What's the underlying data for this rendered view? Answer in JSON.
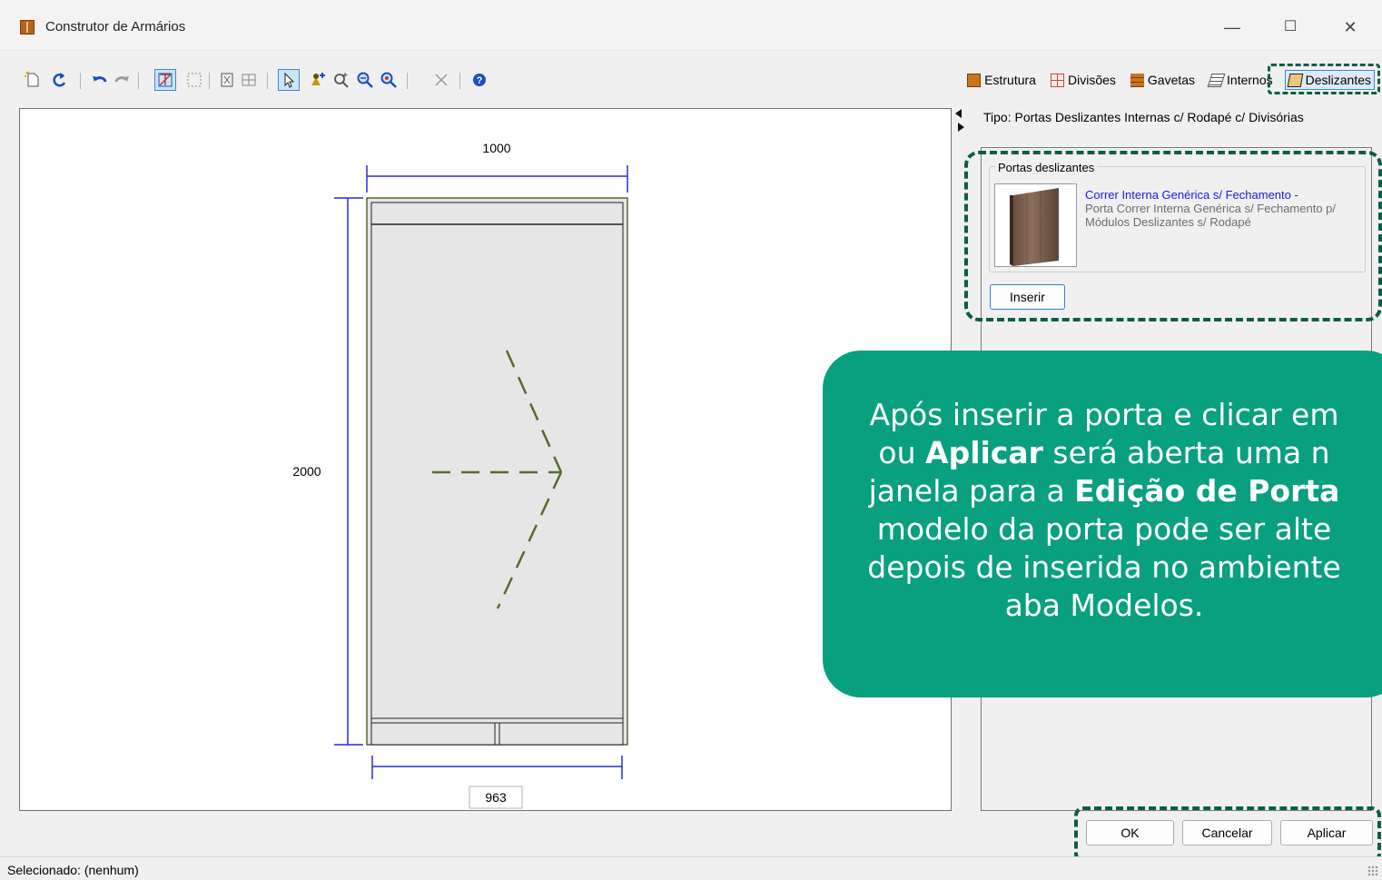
{
  "window": {
    "title": "Construtor de Armários",
    "minimize_glyph": "—",
    "maximize_glyph": "☐",
    "close_glyph": "✕"
  },
  "toolbar": {
    "icons": [
      "new-icon",
      "redo-icon",
      "undo-icon",
      "redo-disabled-icon",
      "dimension-icon",
      "select-area-icon",
      "frame-icon",
      "grid-icon",
      "pointer-icon",
      "add-item-icon",
      "zoom-in-icon",
      "zoom-out-icon",
      "zoom-fit-icon",
      "delete-icon",
      "help-icon"
    ]
  },
  "tabs": [
    {
      "label": "Estrutura",
      "icon": "cabinet-icon"
    },
    {
      "label": "Divisões",
      "icon": "divisions-icon"
    },
    {
      "label": "Gavetas",
      "icon": "drawers-icon"
    },
    {
      "label": "Internos",
      "icon": "internals-icon"
    },
    {
      "label": "Deslizantes",
      "icon": "sliding-doors-icon",
      "active": true
    }
  ],
  "drawing": {
    "width_label": "1000",
    "height_label": "2000",
    "inner_width_label": "963"
  },
  "panel": {
    "tipo": "Tipo: Portas Deslizantes Internas c/ Rodapé c/ Divisórias",
    "group_label": "Portas deslizantes",
    "item_title": "Correr Interna Genérica s/ Fechamento -",
    "item_desc": "Porta Correr Interna Genérica s/ Fechamento p/ Módulos Deslizantes s/ Rodapé",
    "insert_button": "Inserir"
  },
  "callout": {
    "line1": "Após inserir a porta e clicar em",
    "line2_pre": "ou ",
    "line2_bold": "Aplicar",
    "line2_post": " será aberta uma n",
    "line3_pre": "janela para a ",
    "line3_bold": "Edição de Porta",
    "line4": "modelo da porta pode ser alte",
    "line5": "depois de inserida no ambiente",
    "line6": "aba Modelos."
  },
  "footer": {
    "ok": "OK",
    "cancel": "Cancelar",
    "apply": "Aplicar"
  },
  "status": {
    "text": "Selecionado: (nenhum)"
  },
  "colors": {
    "accent_blue": "#3d86d8",
    "callout_green": "#08a07f",
    "dash_green": "#0b5e45",
    "dimension_blue": "#2a2ad6"
  }
}
